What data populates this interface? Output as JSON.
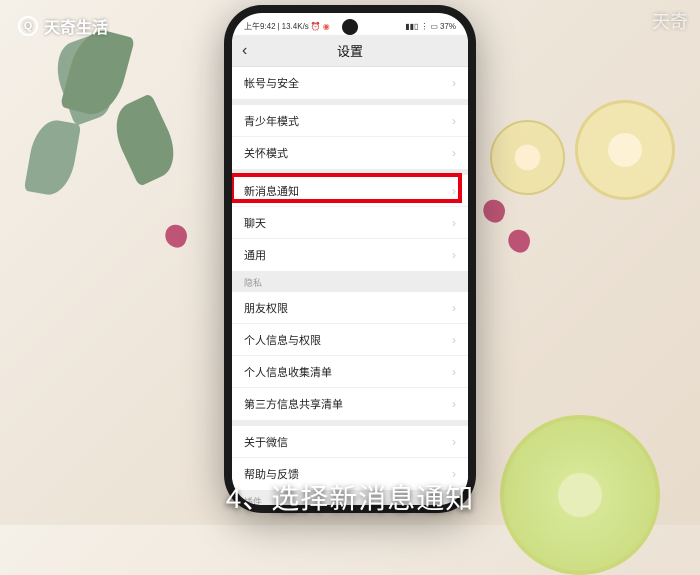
{
  "watermark": {
    "top_right": "天奇",
    "logo_text": "天奇生活",
    "logo_glyph": "Q"
  },
  "caption": "4、选择新消息通知",
  "phone": {
    "status": {
      "time": "上午9:42",
      "speed": "13.4K/s",
      "alarm": "⏰",
      "rec": "◉",
      "signal": "▮▮▯",
      "wifi": "⋮",
      "battery": "37%"
    },
    "nav": {
      "back": "‹",
      "title": "设置"
    },
    "sections": [
      {
        "header": null,
        "rows": [
          "帐号与安全"
        ]
      },
      {
        "header": null,
        "rows": [
          "青少年模式",
          "关怀模式"
        ]
      },
      {
        "header": null,
        "rows": [
          "新消息通知",
          "聊天",
          "通用"
        ]
      },
      {
        "header": "隐私",
        "rows": [
          "朋友权限",
          "个人信息与权限",
          "个人信息收集清单",
          "第三方信息共享清单"
        ]
      },
      {
        "header": null,
        "rows": [
          "关于微信",
          "帮助与反馈"
        ]
      },
      {
        "header": "插件",
        "rows": []
      }
    ],
    "highlighted_row": "新消息通知"
  }
}
